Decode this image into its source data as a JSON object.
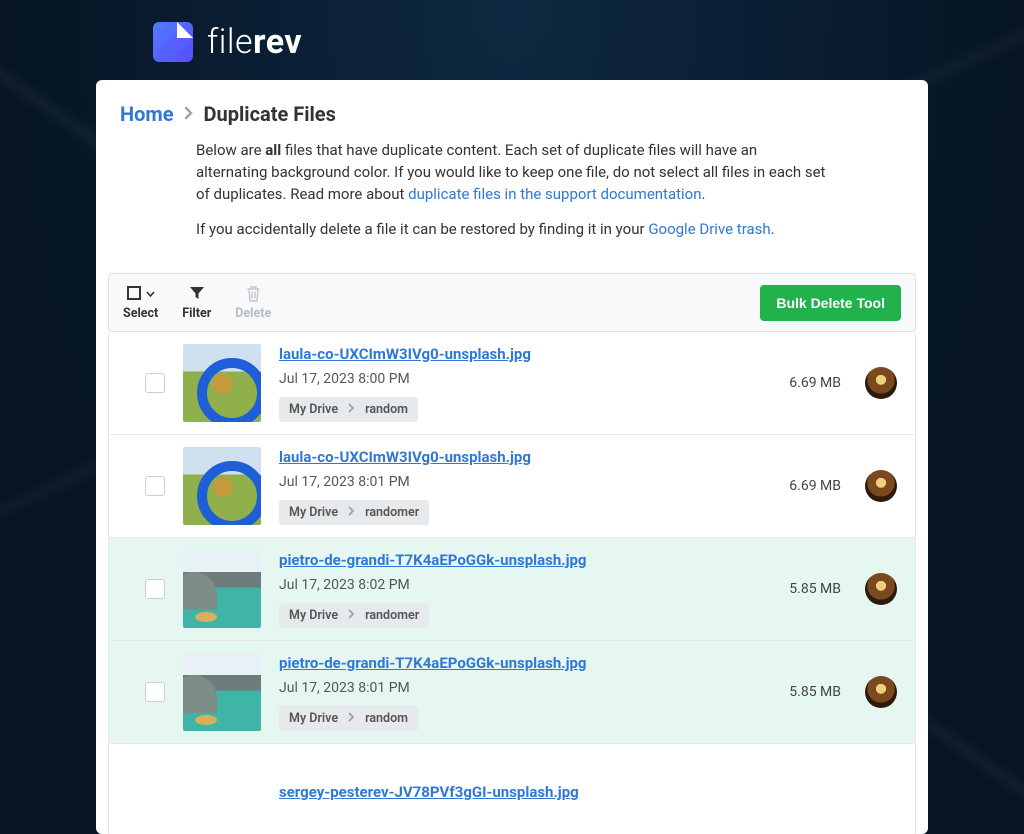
{
  "brand": {
    "name_light": "file",
    "name_bold": "rev"
  },
  "breadcrumb": {
    "home": "Home",
    "current": "Duplicate Files"
  },
  "intro": {
    "line1_a": "Below are ",
    "line1_bold": "all",
    "line1_b": " files that have duplicate content. Each set of duplicate files will have an alternating background color. If you would like to keep one file, do not select all files in each set of duplicates. Read more about ",
    "link1": "duplicate files in the support documentation",
    "line1_c": ".",
    "line2_a": "If you accidentally delete a file it can be restored by finding it in your ",
    "link2": "Google Drive trash",
    "line2_b": "."
  },
  "toolbar": {
    "select": "Select",
    "filter": "Filter",
    "delete": "Delete",
    "bulk": "Bulk Delete Tool"
  },
  "files": [
    {
      "name": "laula-co-UXCImW3IVg0-unsplash.jpg",
      "date": "Jul 17, 2023 8:00 PM",
      "size": "6.69 MB",
      "path_root": "My Drive",
      "path_folder": "random",
      "thumb": "dog",
      "alt": false
    },
    {
      "name": "laula-co-UXCImW3IVg0-unsplash.jpg",
      "date": "Jul 17, 2023 8:01 PM",
      "size": "6.69 MB",
      "path_root": "My Drive",
      "path_folder": "randomer",
      "thumb": "dog",
      "alt": false
    },
    {
      "name": "pietro-de-grandi-T7K4aEPoGGk-unsplash.jpg",
      "date": "Jul 17, 2023 8:02 PM",
      "size": "5.85 MB",
      "path_root": "My Drive",
      "path_folder": "randomer",
      "thumb": "lake",
      "alt": true
    },
    {
      "name": "pietro-de-grandi-T7K4aEPoGGk-unsplash.jpg",
      "date": "Jul 17, 2023 8:01 PM",
      "size": "5.85 MB",
      "path_root": "My Drive",
      "path_folder": "random",
      "thumb": "lake",
      "alt": true
    }
  ],
  "partial_next": {
    "name": "sergey-pesterev-JV78PVf3gGI-unsplash.jpg"
  }
}
